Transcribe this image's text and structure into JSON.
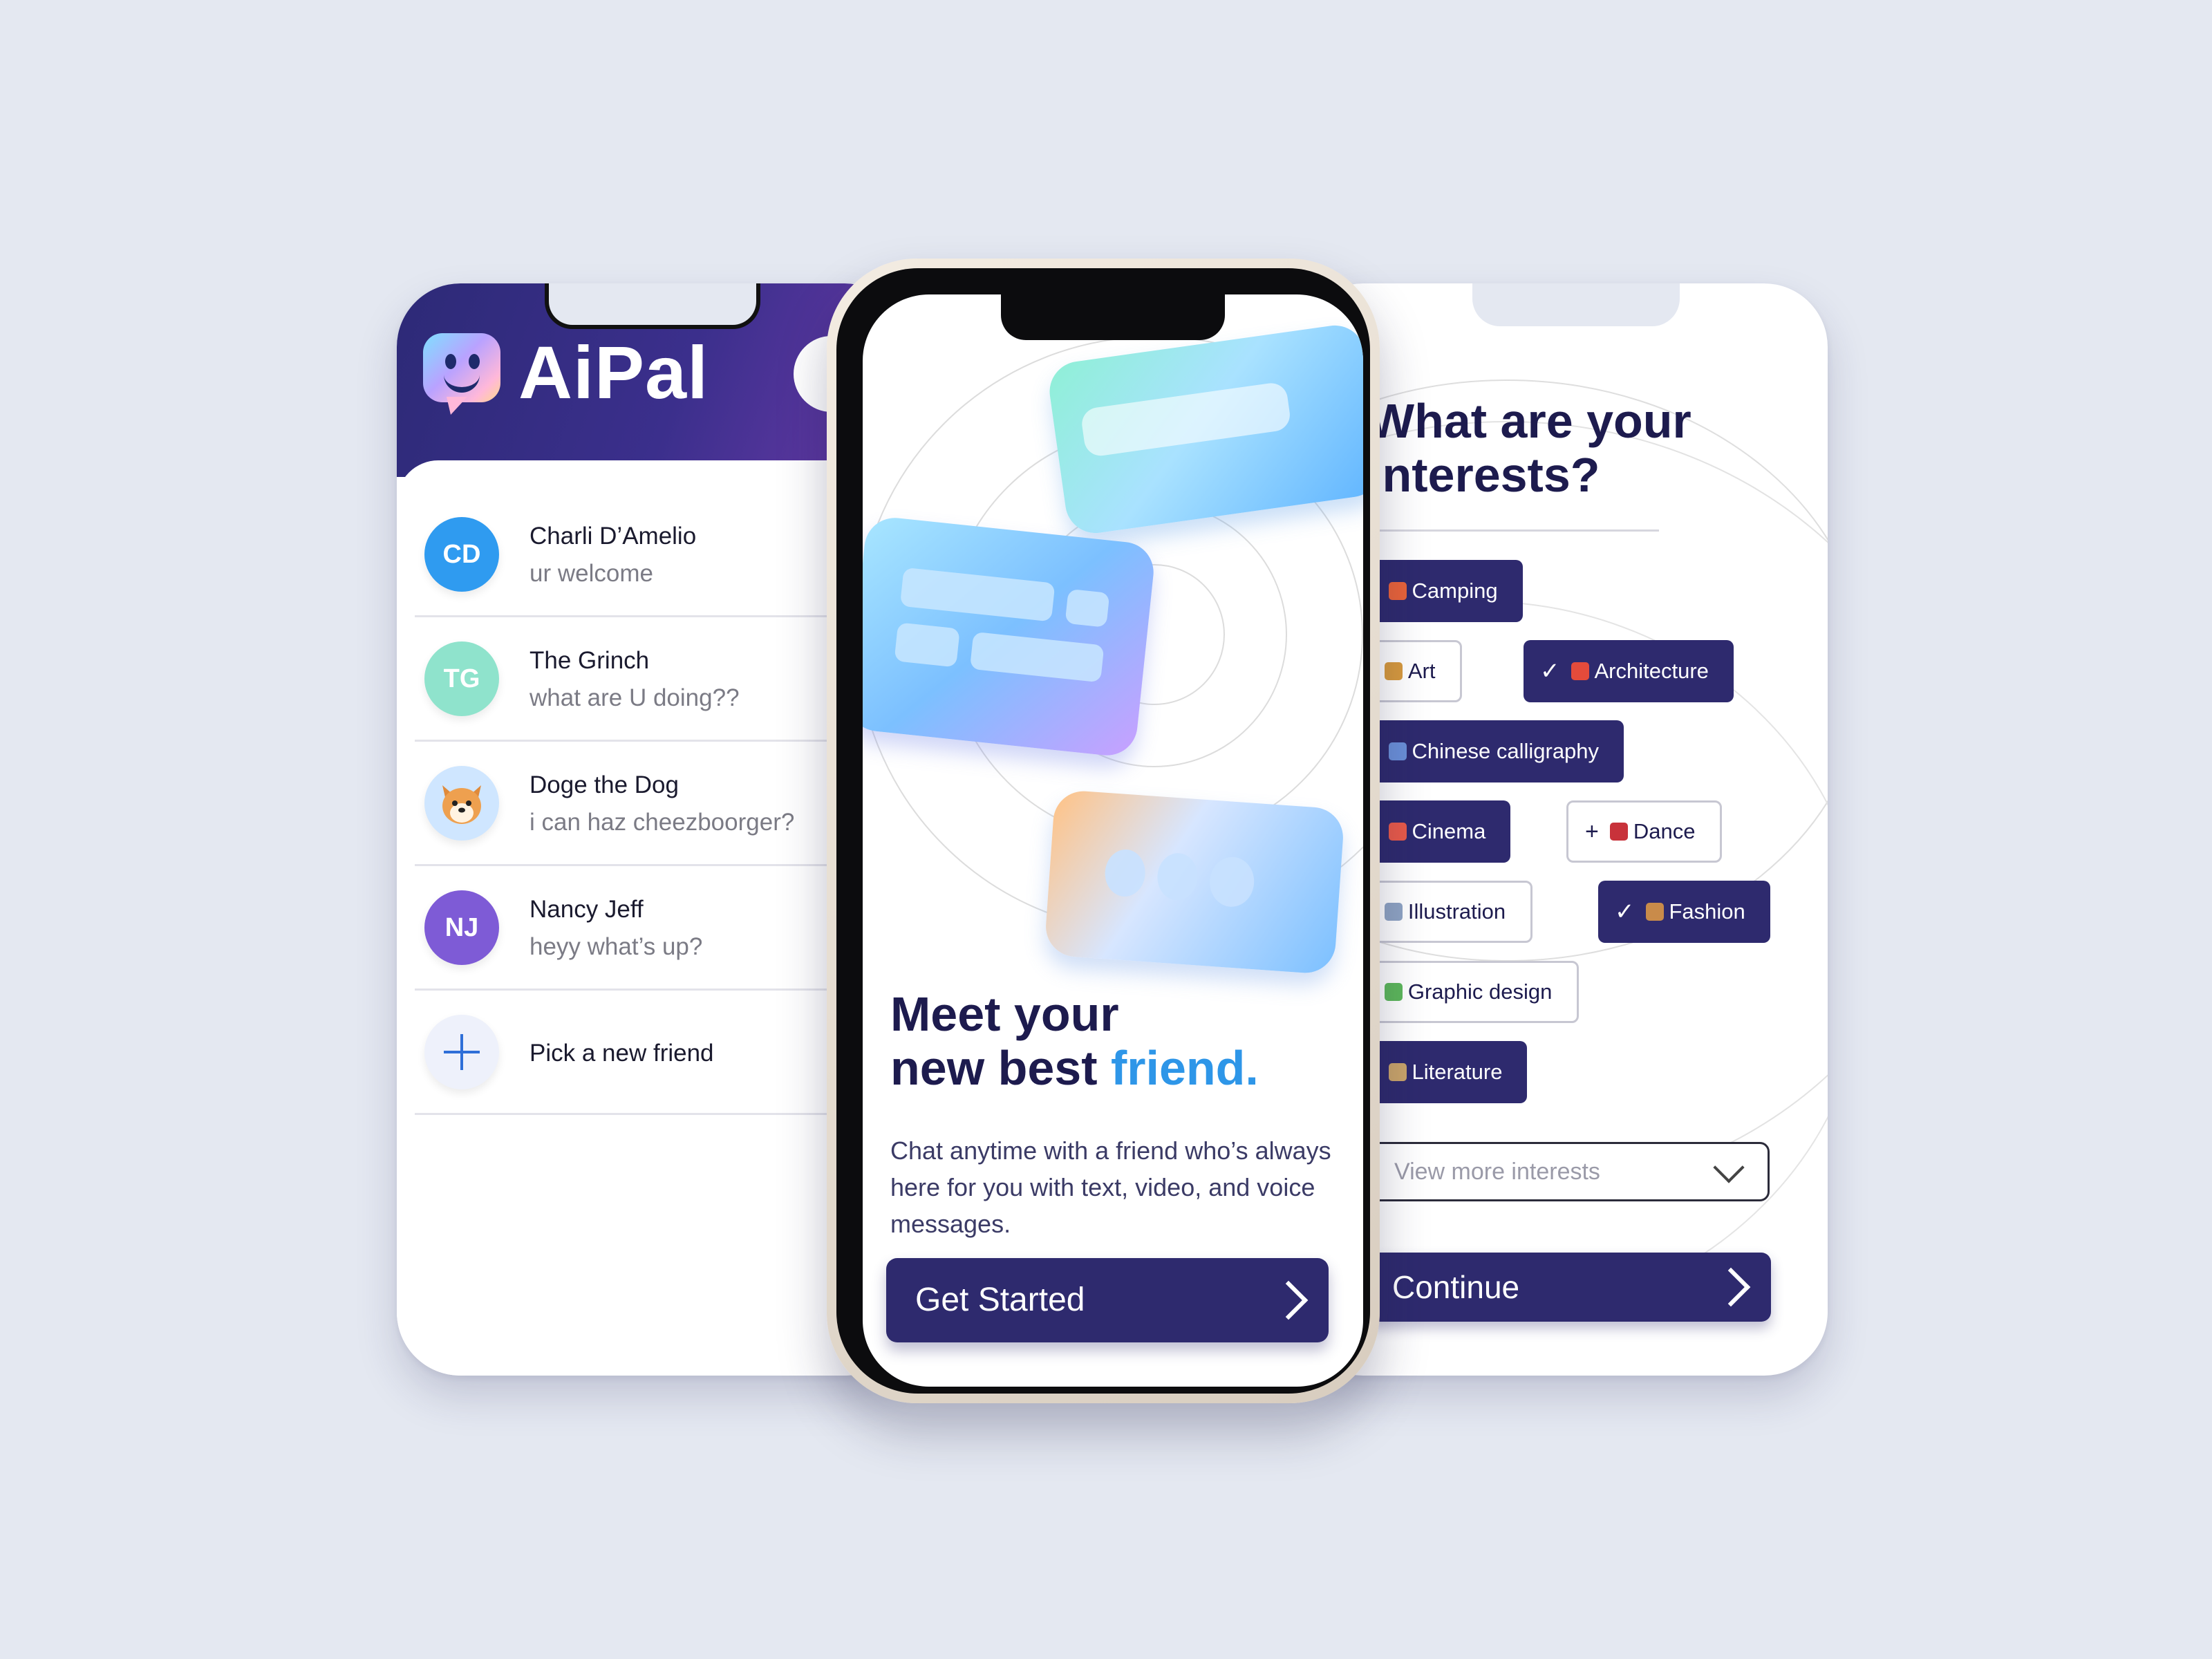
{
  "left_screen": {
    "brand": "AiPal",
    "contacts": [
      {
        "initials": "CD",
        "name": "Charli D’Amelio",
        "message": "ur welcome",
        "color": "#2f9bf0"
      },
      {
        "initials": "TG",
        "name": "The Grinch",
        "message": "what are U doing??",
        "color": "#8fe3cc"
      },
      {
        "initials": "",
        "name": "Doge the Dog",
        "message": "i can haz cheezboorger?",
        "color": "#cfe6ff"
      },
      {
        "initials": "NJ",
        "name": "Nancy Jeff",
        "message": "heyy what’s up?",
        "color": "#7e5bd6"
      }
    ],
    "new_friend_label": "Pick a new friend"
  },
  "center_screen": {
    "headline_line1": "Meet your",
    "headline_line2_plain": "new best ",
    "headline_line2_accent": "friend.",
    "subtext": "Chat anytime with a friend who’s always here for you with text, video, and voice messages.",
    "cta_label": "Get Started",
    "accent_color": "#2e96e8",
    "primary_color": "#2e2a6e"
  },
  "right_screen": {
    "title": "What are your interests?",
    "interests": [
      {
        "label": "Camping",
        "selected": true
      },
      {
        "label": "Art",
        "selected": false
      },
      {
        "label": "Architecture",
        "selected": true
      },
      {
        "label": "Chinese calligraphy",
        "selected": true
      },
      {
        "label": "Cinema",
        "selected": true
      },
      {
        "label": "Dance",
        "selected": false
      },
      {
        "label": "Illustration",
        "selected": false
      },
      {
        "label": "Fashion",
        "selected": true
      },
      {
        "label": "Graphic design",
        "selected": false
      },
      {
        "label": "Literature",
        "selected": true
      }
    ],
    "view_more_placeholder": "View more interests",
    "continue_label": "Continue"
  }
}
